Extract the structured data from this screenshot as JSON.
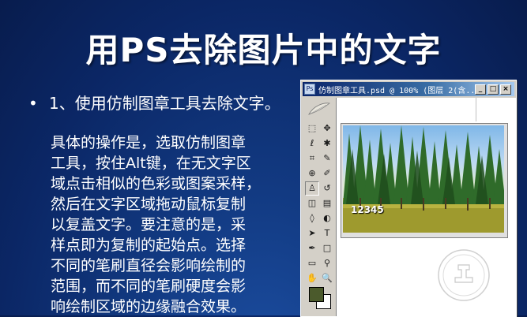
{
  "slide": {
    "title": "用PS去除图片中的文字",
    "bullet": "1、使用仿制图章工具去除文字。",
    "bullet_marker": "•",
    "body_lines": [
      "具体的操作是，选取仿制图章",
      "工具，按住Alt键，在无文字区",
      "域点击相似的色彩或图案采样，",
      "然后在文字区域拖动鼠标复制",
      "以复盖文字。要注意的是，采",
      "样点即为复制的起始点。选择",
      "不同的笔刷直径会影响绘制的",
      "范围，而不同的笔刷硬度会影",
      "响绘制区域的边缘融合效果。"
    ]
  },
  "ps_window": {
    "title": "仿制图章工具.psd @ 100% (图层 2(含...",
    "minimize": "_",
    "maximize": "□",
    "close": "×",
    "photo_text": "12345",
    "fg_color": "#4b5a2c",
    "bg_color": "#ffffff"
  },
  "toolbox": {
    "tools": [
      {
        "icon": "marquee-icon",
        "glyph": "⬚"
      },
      {
        "icon": "move-icon",
        "glyph": "✥"
      },
      {
        "icon": "lasso-icon",
        "glyph": "ℓ"
      },
      {
        "icon": "magic-wand-icon",
        "glyph": "✱"
      },
      {
        "icon": "crop-icon",
        "glyph": "⌗"
      },
      {
        "icon": "slice-icon",
        "glyph": "✎"
      },
      {
        "icon": "healing-brush-icon",
        "glyph": "⊕"
      },
      {
        "icon": "brush-icon",
        "glyph": "✐"
      },
      {
        "icon": "clone-stamp-icon",
        "glyph": "♙"
      },
      {
        "icon": "history-brush-icon",
        "glyph": "↺"
      },
      {
        "icon": "eraser-icon",
        "glyph": "◫"
      },
      {
        "icon": "gradient-icon",
        "glyph": "▤"
      },
      {
        "icon": "blur-icon",
        "glyph": "◊"
      },
      {
        "icon": "dodge-icon",
        "glyph": "◐"
      },
      {
        "icon": "path-select-icon",
        "glyph": "➤"
      },
      {
        "icon": "type-icon",
        "glyph": "T"
      },
      {
        "icon": "pen-icon",
        "glyph": "✒"
      },
      {
        "icon": "shape-icon",
        "glyph": "□"
      },
      {
        "icon": "notes-icon",
        "glyph": "▭"
      },
      {
        "icon": "eyedropper-icon",
        "glyph": "⚲"
      },
      {
        "icon": "hand-icon",
        "glyph": "✋"
      },
      {
        "icon": "zoom-icon",
        "glyph": "🔍"
      }
    ]
  }
}
